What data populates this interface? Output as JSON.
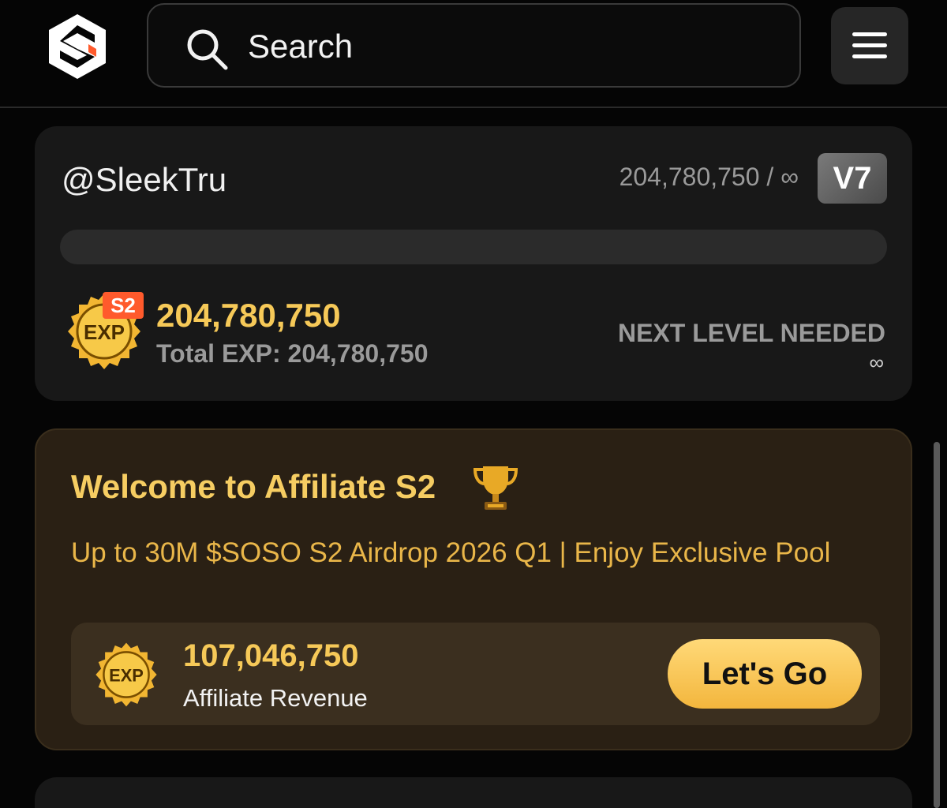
{
  "header": {
    "search_placeholder": "Search",
    "logo_icon": "brand-logo-icon",
    "menu_icon": "hamburger-menu-icon"
  },
  "profile": {
    "username": "@SleekTru",
    "exp_ratio": "204,780,750 / ∞",
    "level": "V7",
    "progress_fraction": 0,
    "exp_badge_label": "EXP",
    "season_tag": "S2",
    "exp_value": "204,780,750",
    "total_exp": "Total EXP: 204,780,750",
    "next_level_label": "NEXT LEVEL NEEDED",
    "next_level_value": "∞"
  },
  "affiliate": {
    "title": "Welcome to Affiliate S2",
    "title_icon": "trophy-icon",
    "subtitle": "Up to 30M $SOSO S2 Airdrop 2026 Q1 | Enjoy Exclusive Pool",
    "exp_badge_label": "EXP",
    "revenue_value": "107,046,750",
    "revenue_label": "Affiliate Revenue",
    "button_label": "Let's Go"
  },
  "colors": {
    "background": "#050505",
    "card": "#181818",
    "accent_gold": "#f6c958",
    "affiliate_bg": "#2a2014",
    "season_tag": "#ff5a2c"
  }
}
